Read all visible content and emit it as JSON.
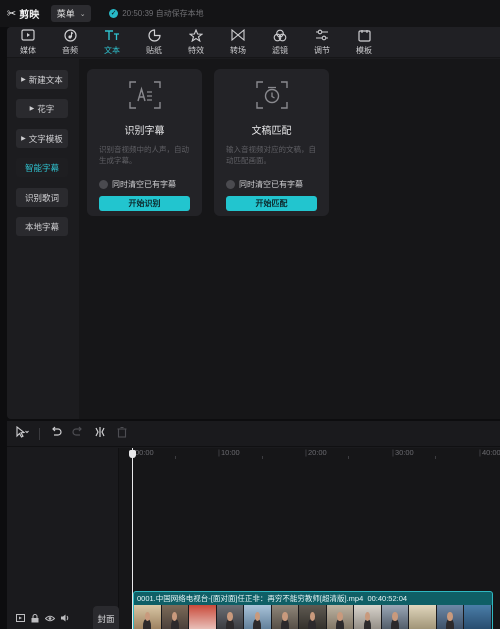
{
  "app": {
    "logo_mark": "✂",
    "name": "剪映",
    "menu_label": "菜单",
    "save_status": "20:50:39 自动保存本地"
  },
  "toolbar": [
    {
      "label": "媒体",
      "icon": "media-icon"
    },
    {
      "label": "音频",
      "icon": "audio-icon"
    },
    {
      "label": "文本",
      "icon": "text-icon",
      "active": true
    },
    {
      "label": "贴纸",
      "icon": "sticker-icon"
    },
    {
      "label": "特效",
      "icon": "effects-icon"
    },
    {
      "label": "转场",
      "icon": "transition-icon"
    },
    {
      "label": "滤镜",
      "icon": "filter-icon"
    },
    {
      "label": "调节",
      "icon": "adjust-icon"
    },
    {
      "label": "模板",
      "icon": "template-icon"
    }
  ],
  "sidebar": {
    "items": [
      {
        "label": "新建文本",
        "expandable": true
      },
      {
        "label": "花字",
        "expandable": true
      },
      {
        "label": "文字模板",
        "expandable": true
      },
      {
        "label": "智能字幕",
        "active": true
      },
      {
        "label": "识别歌词"
      },
      {
        "label": "本地字幕"
      }
    ]
  },
  "cards": [
    {
      "title": "识别字幕",
      "icon": "recognize-subtitle-icon",
      "desc": "识别音视频中的人声，自动生成字幕。",
      "option": "同时清空已有字幕",
      "button": "开始识别"
    },
    {
      "title": "文稿匹配",
      "icon": "script-match-icon",
      "desc": "输入音视频对应的文稿，自动匹配画面。",
      "option": "同时清空已有字幕",
      "button": "开始匹配"
    }
  ],
  "timeline": {
    "ruler": [
      "00:00",
      "10:00",
      "20:00",
      "30:00",
      "40:00"
    ],
    "cover_label": "封面",
    "clip": {
      "filename": "0001.中国网络电视台-[面对面]任正非：再穷不能穷教师[超清版].mp4",
      "duration": "00:40:52:04"
    }
  },
  "colors": {
    "accent": "#22c5cf",
    "background": "#0d0d0f",
    "panel": "#1c1c1f"
  }
}
